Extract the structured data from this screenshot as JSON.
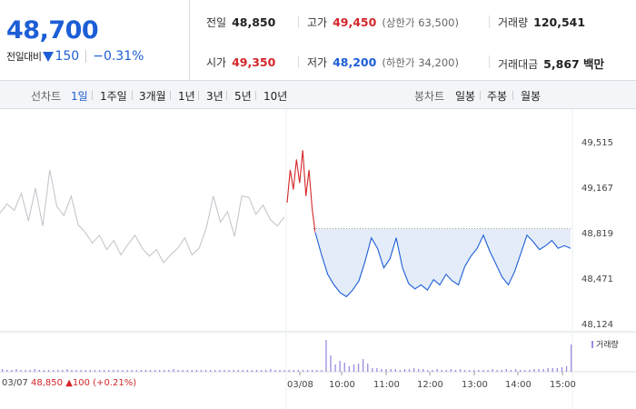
{
  "summary": {
    "price": "48,700",
    "change_label": "전일대비",
    "change_amount": "150",
    "change_pct": "−0.31%",
    "prev_close_label": "전일",
    "prev_close": "48,850",
    "high_label": "고가",
    "high": "49,450",
    "upper_limit": "(상한가 63,500)",
    "volume_label": "거래량",
    "volume": "120,541",
    "open_label": "시가",
    "open": "49,350",
    "low_label": "저가",
    "low": "48,200",
    "lower_limit": "(하한가 34,200)",
    "amount_label": "거래대금",
    "amount": "5,867 백만"
  },
  "tabs": {
    "line_label": "선차트",
    "line_periods": [
      "1일",
      "1주일",
      "3개월",
      "1년",
      "3년",
      "5년",
      "10년"
    ],
    "active_period": "1일",
    "candle_label": "봉차트",
    "candle_periods": [
      "일봉",
      "주봉",
      "월봉"
    ]
  },
  "chart_data": {
    "type": "line",
    "y_ticks": [
      "49,515",
      "49,167",
      "48,819",
      "48,471",
      "48,124"
    ],
    "ylim": [
      48124,
      49515
    ],
    "baseline": 48850,
    "x_ticks": [
      "03/07",
      "03/08",
      "10:00",
      "11:00",
      "12:00",
      "13:00",
      "14:00",
      "15:00"
    ],
    "series": [
      {
        "values": [
          48970,
          49040,
          48990,
          49120,
          48910,
          49160,
          48870,
          49300,
          49020,
          48950,
          49100,
          48880,
          48820,
          48740,
          48800,
          48690,
          48760,
          48650,
          48730,
          48800,
          48700,
          48640,
          48690,
          48590,
          48650,
          48700,
          48780,
          48650,
          48700,
          48850,
          49100,
          48900,
          48980,
          48790,
          49100,
          49090,
          48960,
          49030,
          48920,
          48870,
          48940
        ]
      },
      {
        "values": [
          49050,
          49300,
          49150,
          49380,
          49200,
          49450,
          49100,
          49300,
          49000,
          48820
        ]
      },
      {
        "values": [
          48820,
          48650,
          48500,
          48420,
          48360,
          48330,
          48380,
          48450,
          48600,
          48780,
          48700,
          48550,
          48620,
          48780,
          48550,
          48430,
          48390,
          48420,
          48380,
          48460,
          48420,
          48500,
          48450,
          48420,
          48560,
          48640,
          48700,
          48800,
          48680,
          48580,
          48480,
          48420,
          48520,
          48660,
          48800,
          48750,
          48690,
          48720,
          48760,
          48700,
          48720,
          48700
        ]
      }
    ],
    "volume_label": "거래량",
    "volume": [
      3,
      2,
      2,
      3,
      2,
      2,
      2,
      3,
      2,
      2,
      2,
      2,
      2,
      2,
      3,
      2,
      2,
      2,
      2,
      2,
      2,
      2,
      2,
      2,
      2,
      2,
      2,
      2,
      2,
      2,
      2,
      2,
      2,
      2,
      2,
      2,
      2,
      3,
      2,
      2,
      2,
      2,
      2,
      2,
      2,
      2,
      2,
      2,
      2,
      2,
      2,
      2,
      2,
      2,
      2,
      2,
      2,
      2,
      3,
      2,
      2,
      2,
      2,
      2,
      2,
      2,
      2,
      2,
      2,
      2,
      35,
      18,
      8,
      12,
      10,
      6,
      8,
      9,
      14,
      9,
      4,
      4,
      3,
      3,
      3,
      3,
      2,
      3,
      3,
      4,
      3,
      3,
      2,
      2,
      3,
      2,
      2,
      3,
      2,
      3,
      2,
      2,
      2,
      2,
      2,
      2,
      3,
      2,
      2,
      3,
      2,
      3,
      2,
      2,
      2,
      3,
      3,
      3,
      4,
      4,
      4,
      5,
      6,
      30
    ]
  },
  "bottom": {
    "date": "03/07",
    "close": "48,850",
    "change": "▲100 (+0.21%)"
  },
  "colors": {
    "up": "#d4262b",
    "down": "#1d5ed6",
    "prev": "#c4c7cc",
    "fill": "#e3ecf8",
    "volume": "#9a8ce0"
  }
}
